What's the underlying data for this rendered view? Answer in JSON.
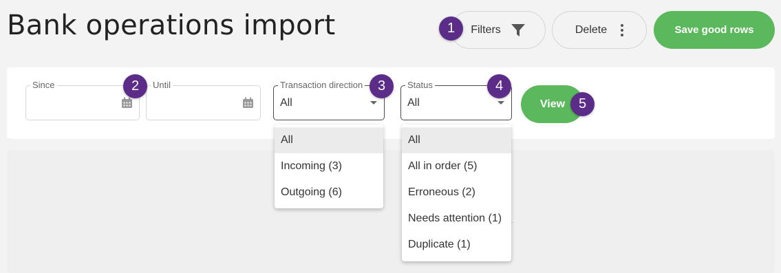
{
  "page": {
    "title": "Bank operations import"
  },
  "toolbar": {
    "filters_label": "Filters",
    "delete_label": "Delete",
    "save_label": "Save good rows"
  },
  "filters": {
    "since": {
      "label": "Since",
      "value": ""
    },
    "until": {
      "label": "Until",
      "value": ""
    },
    "direction": {
      "label": "Transaction direction",
      "value": "All",
      "options": [
        "All",
        "Incoming (3)",
        "Outgoing (6)"
      ]
    },
    "status": {
      "label": "Status",
      "value": "All",
      "options": [
        "All",
        "All in order (5)",
        "Erroneous (2)",
        "Needs attention (1)",
        "Duplicate (1)"
      ]
    },
    "view_label": "View"
  },
  "markers": [
    "1",
    "2",
    "3",
    "4",
    "5"
  ],
  "colors": {
    "accent": "#5cb85c",
    "marker": "#5b2c88"
  },
  "icons": [
    "filter-icon",
    "kebab-menu-icon",
    "calendar-icon",
    "dropdown-caret-icon"
  ]
}
